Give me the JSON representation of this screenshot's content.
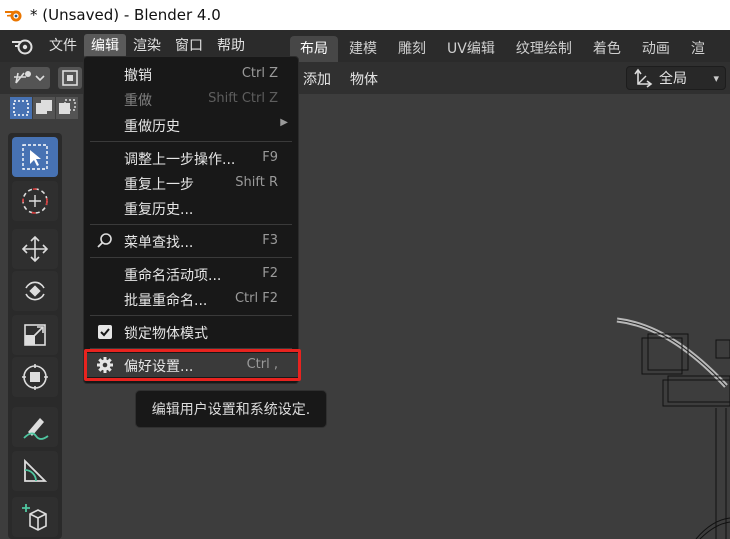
{
  "window": {
    "title": "* (Unsaved) - Blender 4.0"
  },
  "menubar": {
    "items": [
      "文件",
      "编辑",
      "渲染",
      "窗口",
      "帮助"
    ],
    "active_index": 1
  },
  "tabs": [
    "布局",
    "建模",
    "雕刻",
    "UV编辑",
    "纹理绘制",
    "着色",
    "动画",
    "渲"
  ],
  "toolbar": {
    "add_label": "添加",
    "object_label": "物体",
    "transform_space": "全局"
  },
  "edit_menu": {
    "items": [
      {
        "label": "撤销",
        "shortcut": "Ctrl Z",
        "enabled": true
      },
      {
        "label": "重做",
        "shortcut": "Shift Ctrl Z",
        "enabled": false
      },
      {
        "label": "重做历史",
        "submenu": true,
        "enabled": true
      },
      {
        "label": "调整上一步操作...",
        "shortcut": "F9",
        "enabled": true
      },
      {
        "label": "重复上一步",
        "shortcut": "Shift R",
        "enabled": true
      },
      {
        "label": "重复历史...",
        "enabled": true
      },
      {
        "label": "菜单查找...",
        "shortcut": "F3",
        "icon": "search-icon",
        "enabled": true
      },
      {
        "label": "重命名活动项...",
        "shortcut": "F2",
        "enabled": true
      },
      {
        "label": "批量重命名...",
        "shortcut": "Ctrl F2",
        "enabled": true
      },
      {
        "label": "锁定物体模式",
        "icon": "checkbox-checked-icon",
        "checked": true,
        "enabled": true
      },
      {
        "label": "偏好设置...",
        "shortcut": "Ctrl ,",
        "icon": "gear-icon",
        "enabled": true,
        "highlighted": true
      }
    ]
  },
  "tooltip": {
    "text": "编辑用户设置和系统设定."
  },
  "colors": {
    "accent_blue": "#4772b3",
    "highlight_red": "#e8231f",
    "menu_bg": "#181818"
  }
}
